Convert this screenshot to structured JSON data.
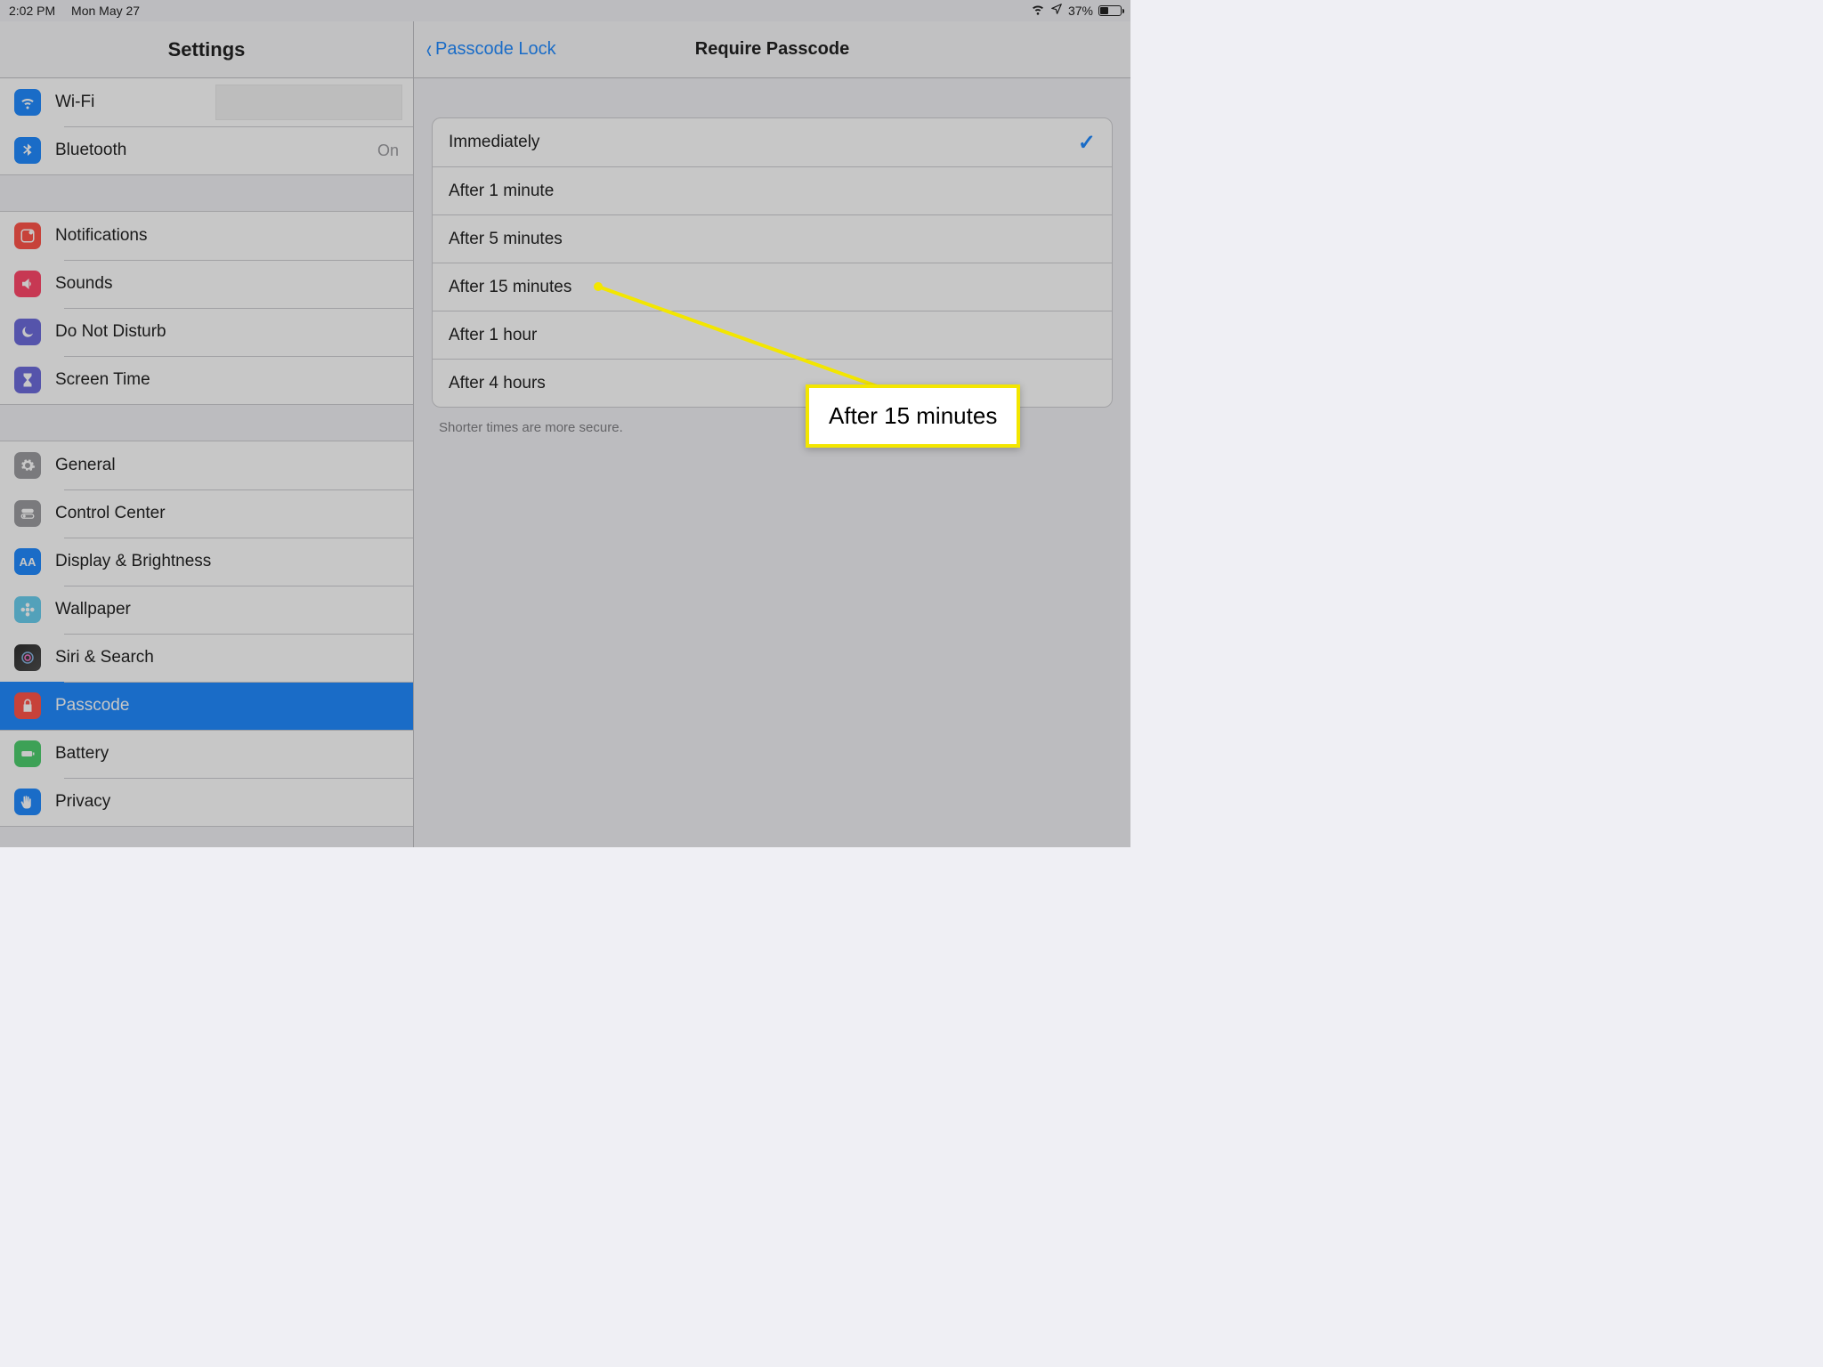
{
  "status": {
    "time": "2:02 PM",
    "date": "Mon May 27",
    "battery_pct": "37%"
  },
  "sidebar": {
    "title": "Settings",
    "groups": [
      {
        "items": [
          {
            "id": "wifi",
            "label": "Wi-Fi",
            "value": "",
            "redacted": true,
            "icon": "wifi-icon",
            "bg": "bg-blue"
          },
          {
            "id": "bluetooth",
            "label": "Bluetooth",
            "value": "On",
            "icon": "bluetooth-icon",
            "bg": "bg-blue"
          }
        ]
      },
      {
        "items": [
          {
            "id": "notifications",
            "label": "Notifications",
            "icon": "notifications-icon",
            "bg": "bg-red"
          },
          {
            "id": "sounds",
            "label": "Sounds",
            "icon": "sounds-icon",
            "bg": "bg-pink"
          },
          {
            "id": "dnd",
            "label": "Do Not Disturb",
            "icon": "moon-icon",
            "bg": "bg-purple"
          },
          {
            "id": "screentime",
            "label": "Screen Time",
            "icon": "hourglass-icon",
            "bg": "bg-indigo"
          }
        ]
      },
      {
        "items": [
          {
            "id": "general",
            "label": "General",
            "icon": "gear-icon",
            "bg": "bg-gray"
          },
          {
            "id": "controlcenter",
            "label": "Control Center",
            "icon": "switch-icon",
            "bg": "bg-gray"
          },
          {
            "id": "display",
            "label": "Display & Brightness",
            "icon": "aa-icon",
            "bg": "bg-blue"
          },
          {
            "id": "wallpaper",
            "label": "Wallpaper",
            "icon": "flower-icon",
            "bg": "bg-teal"
          },
          {
            "id": "siri",
            "label": "Siri & Search",
            "icon": "siri-icon",
            "bg": "bg-black"
          },
          {
            "id": "passcode",
            "label": "Passcode",
            "icon": "lock-icon",
            "bg": "bg-red",
            "selected": true
          },
          {
            "id": "battery",
            "label": "Battery",
            "icon": "battery-icon",
            "bg": "bg-green"
          },
          {
            "id": "privacy",
            "label": "Privacy",
            "icon": "hand-icon",
            "bg": "bg-blue"
          }
        ]
      }
    ]
  },
  "detail": {
    "back_label": "Passcode Lock",
    "title": "Require Passcode",
    "options": [
      {
        "label": "Immediately",
        "selected": true
      },
      {
        "label": "After 1 minute"
      },
      {
        "label": "After 5 minutes"
      },
      {
        "label": "After 15 minutes"
      },
      {
        "label": "After 1 hour"
      },
      {
        "label": "After 4 hours"
      }
    ],
    "footer": "Shorter times are more secure."
  },
  "callout": {
    "text": "After 15 minutes"
  }
}
